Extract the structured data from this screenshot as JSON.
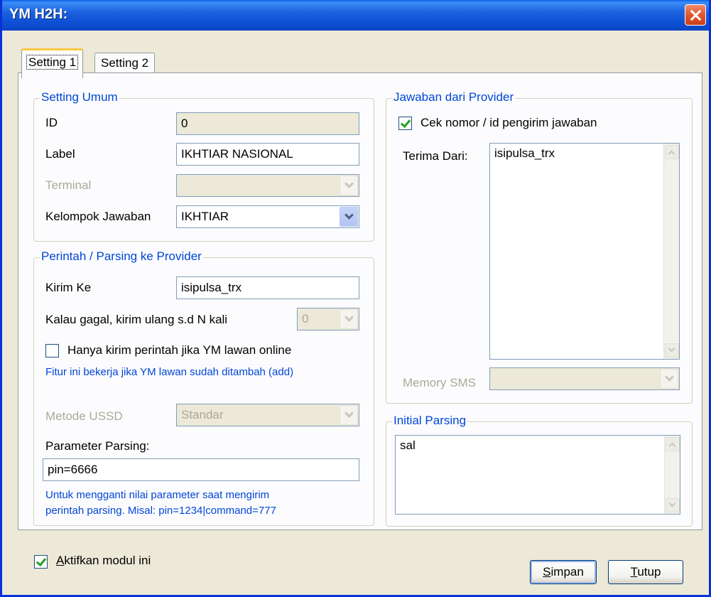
{
  "window": {
    "title": "YM H2H:"
  },
  "tabs": [
    {
      "label": "Setting 1",
      "active": true
    },
    {
      "label": "Setting 2",
      "active": false
    }
  ],
  "setting_umum": {
    "legend": "Setting Umum",
    "id_label": "ID",
    "id_value": "0",
    "label_label": "Label",
    "label_value": "IKHTIAR NASIONAL",
    "terminal_label": "Terminal",
    "terminal_value": "",
    "kelompok_label": "Kelompok Jawaban",
    "kelompok_value": "IKHTIAR"
  },
  "perintah": {
    "legend": "Perintah / Parsing ke Provider",
    "kirim_ke_label": "Kirim Ke",
    "kirim_ke_value": "isipulsa_trx",
    "retry_label": "Kalau gagal, kirim ulang s.d N kali",
    "retry_value": "0",
    "online_only_label": "Hanya kirim perintah jika YM lawan online",
    "online_only_checked": false,
    "online_note": "Fitur ini bekerja jika YM lawan sudah ditambah (add)",
    "ussd_label": "Metode USSD",
    "ussd_value": "Standar",
    "param_label": "Parameter Parsing:",
    "param_value": "pin=6666",
    "param_note_1": "Untuk mengganti nilai parameter saat mengirim",
    "param_note_2": "perintah parsing. Misal: pin=1234|command=777"
  },
  "jawaban": {
    "legend": "Jawaban dari Provider",
    "cek_label": "Cek nomor / id pengirim jawaban",
    "cek_checked": true,
    "terima_label": "Terima Dari:",
    "terima_value": "isipulsa_trx",
    "memory_label": "Memory SMS",
    "memory_value": ""
  },
  "initial_parsing": {
    "legend": "Initial Parsing",
    "value": "sal"
  },
  "footer": {
    "aktifkan_prefix": "A",
    "aktifkan_rest": "ktifkan modul ini",
    "aktifkan_checked": true,
    "simpan_prefix": "S",
    "simpan_rest": "impan",
    "tutup_prefix": "T",
    "tutup_rest": "utup"
  },
  "colors": {
    "titlebar": "#0f52d6",
    "legend_text": "#0046d5",
    "window_bg": "#ece9d8",
    "tab_panel_bg": "#fcfcfe"
  }
}
